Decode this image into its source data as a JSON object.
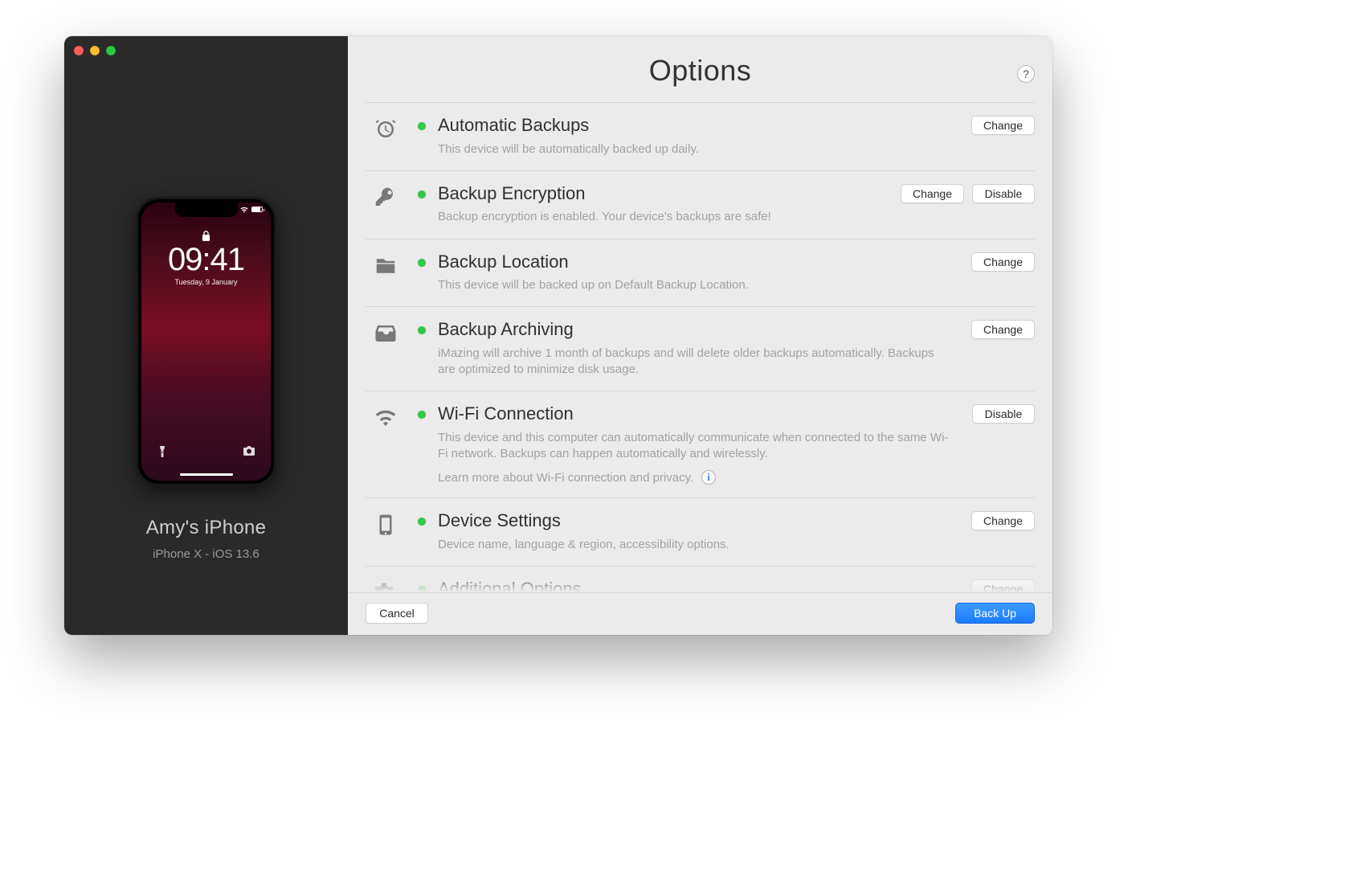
{
  "sidebar": {
    "device_name": "Amy's iPhone",
    "device_sub": "iPhone X - iOS 13.6",
    "lock": {
      "time": "09:41",
      "date": "Tuesday, 9 January"
    }
  },
  "header": {
    "title": "Options",
    "help_label": "?"
  },
  "options": [
    {
      "title": "Automatic Backups",
      "desc": "This device will be automatically backed up daily.",
      "status": "green",
      "actions": [
        "Change"
      ]
    },
    {
      "title": "Backup Encryption",
      "desc": "Backup encryption is enabled. Your device's backups are safe!",
      "status": "green",
      "actions": [
        "Change",
        "Disable"
      ]
    },
    {
      "title": "Backup Location",
      "desc": "This device will be backed up on Default Backup Location.",
      "status": "green",
      "actions": [
        "Change"
      ]
    },
    {
      "title": "Backup Archiving",
      "desc": "iMazing will archive 1 month of backups and will delete older backups automatically. Backups are optimized to minimize disk usage.",
      "status": "green",
      "actions": [
        "Change"
      ]
    },
    {
      "title": "Wi-Fi Connection",
      "desc": "This device and this computer can automatically communicate when connected to the same Wi-Fi network. Backups can happen automatically and wirelessly.",
      "extra": "Learn more about Wi-Fi connection and privacy.",
      "info": "i",
      "status": "green",
      "actions": [
        "Disable"
      ]
    },
    {
      "title": "Device Settings",
      "desc": "Device name, language & region, accessibility options.",
      "status": "green",
      "actions": [
        "Change"
      ]
    },
    {
      "title": "Additional Options",
      "desc": "",
      "status": "green",
      "actions": [
        "Change"
      ]
    }
  ],
  "footer": {
    "cancel": "Cancel",
    "primary": "Back Up"
  },
  "colors": {
    "status_green": "#34c749",
    "primary_blue": "#1a7cff"
  }
}
